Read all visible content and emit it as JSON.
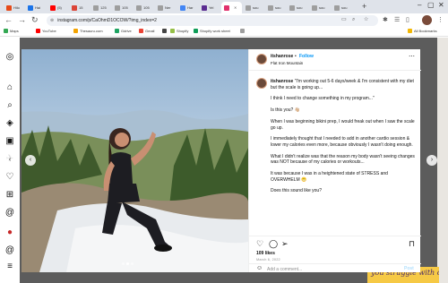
{
  "browser": {
    "tabs": [
      {
        "label": "Hilo",
        "color": "#e64a19",
        "active": false
      },
      {
        "label": "Hai",
        "color": "#1a73e8",
        "active": false
      },
      {
        "label": "(5)",
        "color": "#ff0000",
        "active": false
      },
      {
        "label": "15",
        "color": "#db4437",
        "active": false
      },
      {
        "label": "125",
        "color": "#9e9e9e",
        "active": false
      },
      {
        "label": "105",
        "color": "#9e9e9e",
        "active": false
      },
      {
        "label": "105",
        "color": "#9e9e9e",
        "active": false
      },
      {
        "label": "Ner",
        "color": "#9e9e9e",
        "active": false
      },
      {
        "label": "Har",
        "color": "#4285f4",
        "active": false
      },
      {
        "label": "Yel",
        "color": "#5b2c91",
        "active": false
      },
      {
        "label": "",
        "color": "#e1306c",
        "active": true
      },
      {
        "label": "sou",
        "color": "#9e9e9e",
        "active": false
      },
      {
        "label": "sou",
        "color": "#9e9e9e",
        "active": false
      },
      {
        "label": "sou",
        "color": "#9e9e9e",
        "active": false
      },
      {
        "label": "sou",
        "color": "#9e9e9e",
        "active": false
      },
      {
        "label": "sou",
        "color": "#9e9e9e",
        "active": false
      }
    ],
    "url": "instagram.com/p/CaOhmD1OCOW/?img_index=2",
    "bookmarks": [
      {
        "label": "Maps",
        "color": "#34a853"
      },
      {
        "label": "YouTube",
        "color": "#ff0000"
      },
      {
        "label": "Thesauru.com",
        "color": "#f4a300"
      },
      {
        "label": "Gdrive",
        "color": "#1fa463"
      },
      {
        "label": "Gmail",
        "color": "#ea4335"
      },
      {
        "label": "",
        "color": "#444444"
      },
      {
        "label": "Shopify",
        "color": "#95bf47"
      },
      {
        "label": "Shopify work sheet",
        "color": "#0f9d58"
      },
      {
        "label": "",
        "color": "#9e9e9e"
      }
    ],
    "all_bookmarks": "All Bookmarks"
  },
  "post": {
    "username": "itshanrose",
    "follow_label": "Follow",
    "location": "Flat Iron Mountain",
    "caption_paragraphs": [
      "I think I need to change something in my program...\"",
      "Is this you? 👋🏼",
      "When I was beginning bikini prep, I would freak out when I saw the scale go up.",
      "I immediately thought that I needed to add in another cardio session & lower my calories even more, because obviously I wasn't doing enough.",
      "What I didn't realize was that the reason my body wasn't seeing changes was NOT because of my calories or workouts...",
      "It was because I was in a heightened state of STRESS and OVERWHELM 😬",
      "Does this sound like you?"
    ],
    "caption_first": "\"I'm working out 5-6 days/week & I'm consistent with my diet but the scale is going up...",
    "likes": "109 likes",
    "date": "March 6, 2022",
    "comment_placeholder": "Add a comment...",
    "post_label": "Post"
  },
  "page_peek": "you struggle with confidence"
}
